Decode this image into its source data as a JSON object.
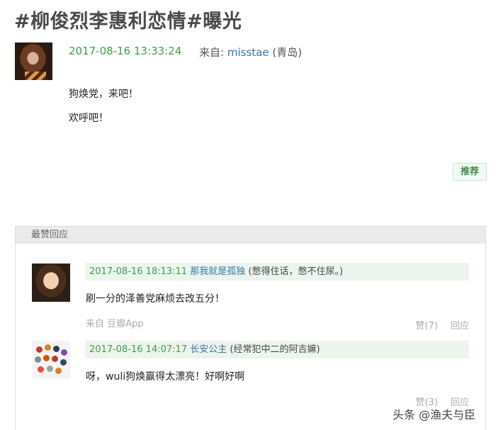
{
  "title": "#柳俊烈李惠利恋情#曝光",
  "post": {
    "date": "2017-08-16 13:33:24",
    "from_label": "来自:",
    "author": "misstae",
    "location": "(青岛)",
    "lines": [
      "狗焕党，来吧！",
      "欢呼吧！"
    ],
    "recommend_label": "推荐"
  },
  "comments_section": {
    "header": "最赞回应",
    "comments": [
      {
        "date": "2017-08-16 18:13:11",
        "user": "那我就是孤独",
        "signature": "(憋得住话，憋不住尿。)",
        "text": "刷一分的泽善党麻烦去改五分！",
        "source": "来自 豆瓣App",
        "like_label": "赞(7)",
        "reply_label": "回应"
      },
      {
        "date": "2017-08-16 14:07:17",
        "user": "长安公主",
        "signature": "(经常犯中二的阿吉嫲)",
        "text": "呀，wuli狗焕赢得太漂亮！好啊好啊",
        "like_label": "赞(3)",
        "reply_label": "回应"
      }
    ]
  },
  "watermark": "头条 @渔夫与臣"
}
